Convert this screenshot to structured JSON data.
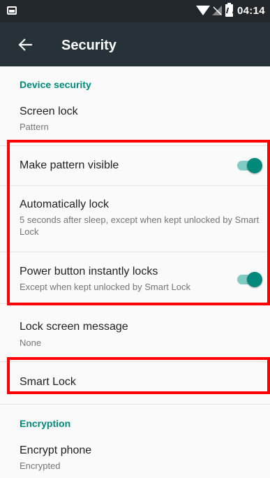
{
  "status_bar": {
    "time": "04:14",
    "icons": [
      "image-icon",
      "wifi-icon",
      "signal-icon",
      "battery-icon"
    ]
  },
  "app_bar": {
    "title": "Security",
    "back_icon": "arrow-back-icon"
  },
  "sections": {
    "device_security": "Device security",
    "encryption": "Encryption"
  },
  "items": {
    "screen_lock": {
      "title": "Screen lock",
      "subtitle": "Pattern"
    },
    "make_pattern_visible": {
      "title": "Make pattern visible",
      "toggle_on": true
    },
    "automatically_lock": {
      "title": "Automatically lock",
      "subtitle": "5 seconds after sleep, except when kept unlocked by Smart Lock"
    },
    "power_button_locks": {
      "title": "Power button instantly locks",
      "subtitle": "Except when kept unlocked by Smart Lock",
      "toggle_on": true
    },
    "lock_screen_message": {
      "title": "Lock screen message",
      "subtitle": "None"
    },
    "smart_lock": {
      "title": "Smart Lock"
    },
    "encrypt_phone": {
      "title": "Encrypt phone",
      "subtitle": "Encrypted"
    }
  },
  "colors": {
    "status_bar": "#21272b",
    "app_bar": "#263238",
    "accent": "#00897b",
    "accent_light": "#80cbc4",
    "highlight": "#ff0000",
    "background": "#fafafa"
  }
}
